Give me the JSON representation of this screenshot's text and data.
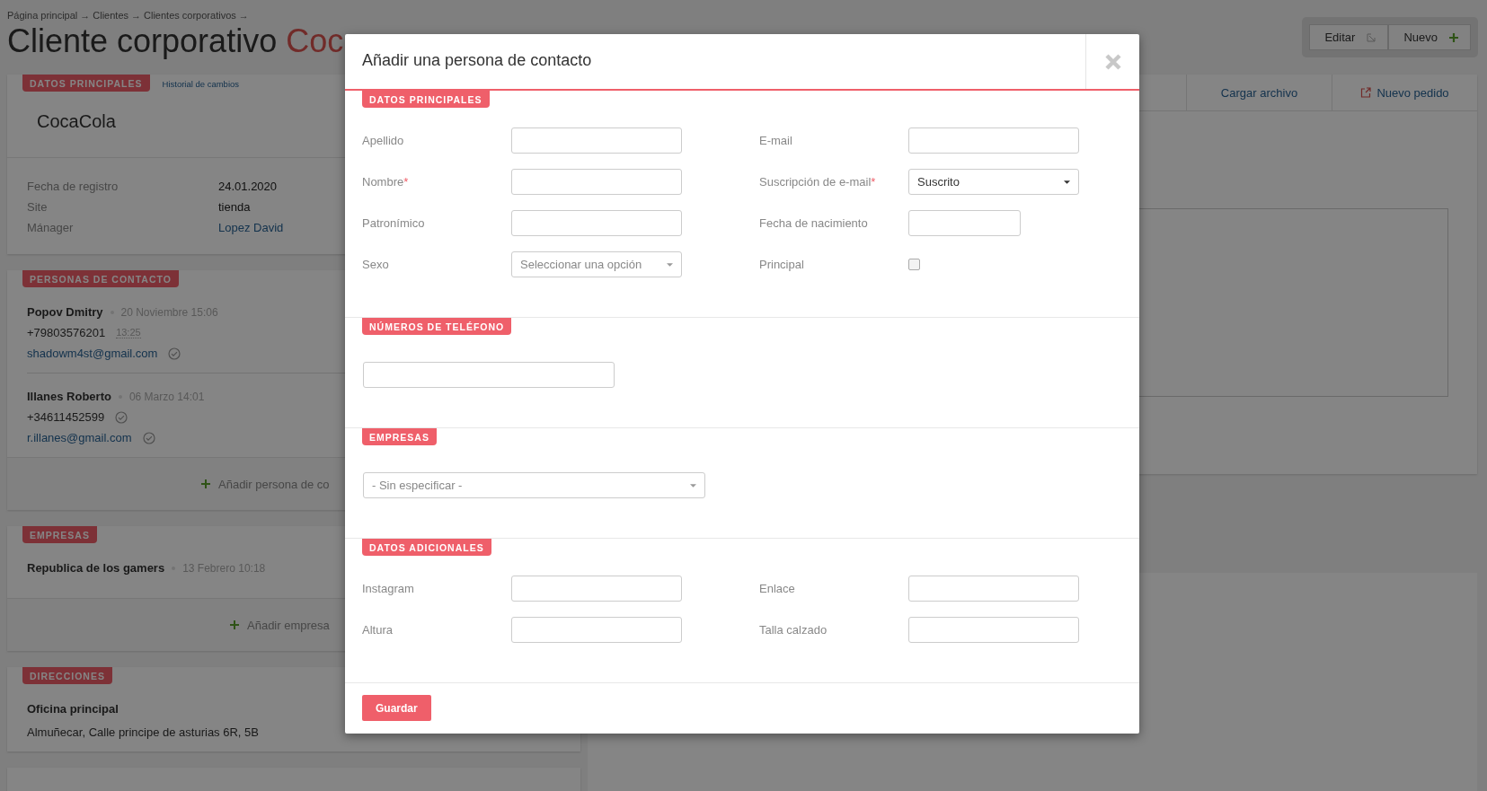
{
  "breadcrumb": {
    "items": [
      "Página principal",
      "Clientes",
      "Clientes corporativos"
    ],
    "separator": "→"
  },
  "page_title": {
    "text": "Cliente corporativo",
    "highlight": "Coc"
  },
  "toolbar": [
    {
      "label": "Editar"
    },
    {
      "label": "Nuevo"
    }
  ],
  "main_card": {
    "tag": "DATOS PRINCIPALES",
    "link": "Historial de cambios",
    "name": "CocaCola",
    "fields": [
      {
        "label": "Fecha de registro",
        "value": "24.01.2020",
        "kind": "text"
      },
      {
        "label": "Site",
        "value": "tienda",
        "kind": "text"
      },
      {
        "label": "Mánager",
        "value": "Lopez David",
        "kind": "link"
      }
    ]
  },
  "contacts": {
    "tag": "PERSONAS DE CONTACTO",
    "items": [
      {
        "name": "Popov Dmitry",
        "date": "20 Noviembre 15:06",
        "phone": "+79803576201",
        "phone_time": "13:25",
        "phone_verified": false,
        "email": "shadowm4st@gmail.com",
        "email_verified": true
      },
      {
        "name": "Illanes Roberto",
        "date": "06 Marzo 14:01",
        "phone": "+34611452599",
        "phone_verified": true,
        "email": "r.illanes@gmail.com",
        "email_verified": true
      }
    ],
    "add": "Añadir persona de co"
  },
  "companies": {
    "tag": "EMPRESAS",
    "items": [
      {
        "name": "Republica de los gamers",
        "date": "13 Febrero 10:18"
      }
    ],
    "add": "Añadir empresa"
  },
  "addresses": {
    "tag": "DIRECCIONES",
    "items": [
      {
        "name": "Oficina principal",
        "address": "Almuñecar, Calle principe de asturias 6R, 5B"
      }
    ]
  },
  "side_tabs": [
    {
      "label": "Cargar archivo"
    },
    {
      "label": "Nuevo pedido"
    }
  ],
  "modal": {
    "title": "Añadir una persona de contacto",
    "required_mark": "*",
    "sections": [
      {
        "kind": "grid",
        "tag": "DATOS PRINCIPALES",
        "fields": [
          {
            "label": "Apellido",
            "kind": "text",
            "required": false
          },
          {
            "label": "E-mail",
            "kind": "text",
            "required": false
          },
          {
            "label": "Nombre",
            "kind": "text",
            "required": true
          },
          {
            "label": "Suscripción de e-mail",
            "kind": "select",
            "required": true,
            "value": "Suscrito"
          },
          {
            "label": "Patronímico",
            "kind": "text",
            "required": false
          },
          {
            "label": "Fecha de nacimiento",
            "kind": "date",
            "required": false
          },
          {
            "label": "Sexo",
            "kind": "select",
            "required": false,
            "placeholder": "Seleccionar una opción"
          },
          {
            "label": "Principal",
            "kind": "checkbox",
            "required": false,
            "checked": false
          }
        ]
      },
      {
        "kind": "phones",
        "tag": "NÚMEROS DE TELÉFONO",
        "fields": [
          {
            "kind": "text"
          }
        ]
      },
      {
        "kind": "companies",
        "tag": "EMPRESAS",
        "fields": [
          {
            "kind": "select",
            "placeholder": "- Sin especificar -"
          }
        ]
      },
      {
        "kind": "grid",
        "tag": "DATOS ADICIONALES",
        "fields": [
          {
            "label": "Instagram",
            "kind": "text",
            "required": false
          },
          {
            "label": "Enlace",
            "kind": "text",
            "required": false
          },
          {
            "label": "Altura",
            "kind": "text",
            "required": false
          },
          {
            "label": "Talla calzado",
            "kind": "text",
            "required": false
          }
        ]
      }
    ],
    "save": "Guardar"
  }
}
